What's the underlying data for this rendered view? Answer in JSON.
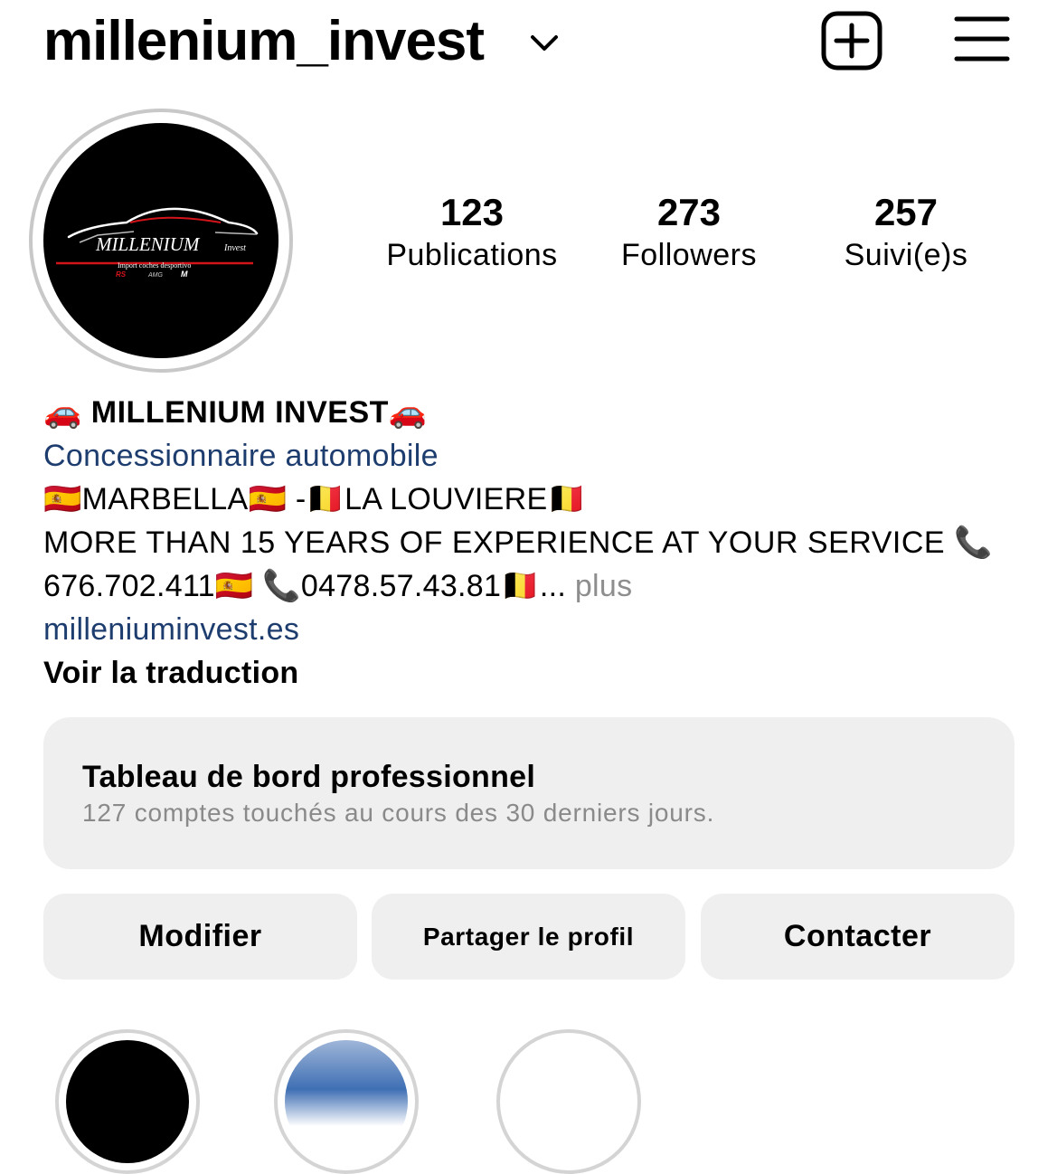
{
  "header": {
    "username": "millenium_invest",
    "icons": {
      "switch_account": "chevron-down-icon",
      "create": "plus-square-icon",
      "menu": "hamburger-menu-icon"
    }
  },
  "avatar": {
    "logo_text": "MILLENIUM",
    "logo_suffix": "Invest",
    "logo_tagline": "Import coches desportivo",
    "badges": [
      "RS",
      "AMG",
      "M"
    ]
  },
  "stats": [
    {
      "value": "123",
      "label": "Publications"
    },
    {
      "value": "273",
      "label": "Followers"
    },
    {
      "value": "257",
      "label": "Suivi(e)s"
    }
  ],
  "bio": {
    "name": "🚗 MILLENIUM INVEST🚗",
    "category": "Concessionnaire automobile",
    "location": "🇪🇸MARBELLA🇪🇸  -🇧🇪LA LOUVIERE🇧🇪",
    "line1": "MORE THAN 15 YEARS OF EXPERIENCE AT YOUR SERVICE 📞",
    "line2": "676.702.411🇪🇸  📞0478.57.43.81🇧🇪...",
    "more": " plus",
    "website": "milleniuminvest.es",
    "translate": "Voir la traduction"
  },
  "dashboard": {
    "title": "Tableau de bord professionnel",
    "subtitle": "127 comptes touchés au cours des 30 derniers jours."
  },
  "actions": {
    "edit": "Modifier",
    "share": "Partager le profil",
    "contact": "Contacter"
  },
  "colors": {
    "link": "#1e3d6f",
    "card_bg": "#efefef",
    "muted": "#8e8e8e",
    "logo_red": "#d3141b"
  }
}
